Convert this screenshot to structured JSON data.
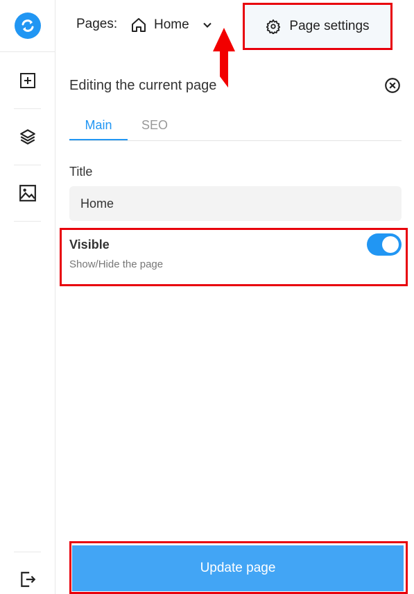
{
  "app": {
    "logo_icon": "refresh-icon",
    "accent": "#2196f3",
    "highlight": "#e8000b"
  },
  "sidebar": {
    "items": [
      {
        "icon": "add-block-icon"
      },
      {
        "icon": "layers-icon"
      },
      {
        "icon": "image-icon"
      }
    ],
    "footer": {
      "icon": "logout-icon"
    }
  },
  "topbar": {
    "pages_label": "Pages:",
    "current_page": "Home",
    "page_settings_label": "Page settings"
  },
  "panel": {
    "title": "Editing the current page",
    "tabs": [
      {
        "label": "Main",
        "active": true
      },
      {
        "label": "SEO",
        "active": false
      }
    ],
    "title_field": {
      "label": "Title",
      "value": "Home"
    },
    "visible": {
      "label": "Visible",
      "description": "Show/Hide the page",
      "enabled": true
    },
    "update_label": "Update page"
  }
}
